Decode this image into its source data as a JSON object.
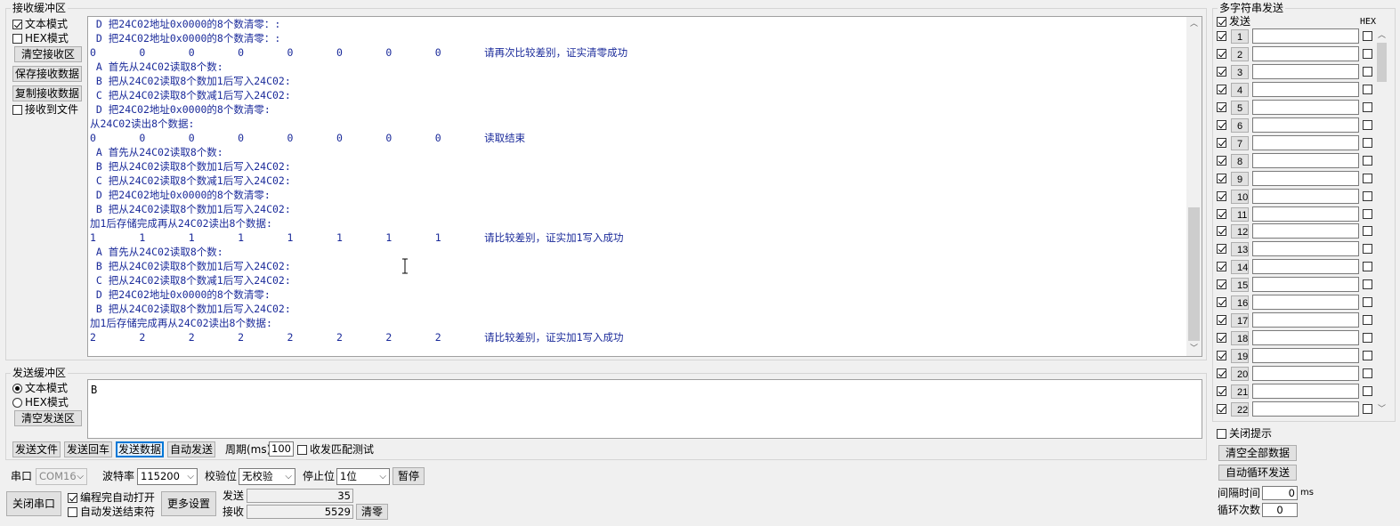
{
  "receive": {
    "group_title": "接收缓冲区",
    "text_mode": "文本模式",
    "hex_mode": "HEX模式",
    "clear_button": "清空接收区",
    "save_button": "保存接收数据",
    "copy_button": "复制接收数据",
    "to_file": "接收到文件",
    "lines": [
      " D 把24C02地址0x0000的8个数清零：:",
      " D 把24C02地址0x0000的8个数清零：:",
      "0       0       0       0       0       0       0       0       请再次比较差别，证实清零成功",
      " A 首先从24C02读取8个数:",
      " B 把从24C02读取8个数加1后写入24C02:",
      " C 把从24C02读取8个数减1后写入24C02:",
      " D 把24C02地址0x0000的8个数清零:",
      "从24C02读出8个数据:",
      "0       0       0       0       0       0       0       0       读取结束",
      " A 首先从24C02读取8个数:",
      " B 把从24C02读取8个数加1后写入24C02:",
      " C 把从24C02读取8个数减1后写入24C02:",
      " D 把24C02地址0x0000的8个数清零:",
      " B 把从24C02读取8个数加1后写入24C02:",
      "加1后存储完成再从24C02读出8个数据:",
      "1       1       1       1       1       1       1       1       请比较差别，证实加1写入成功",
      " A 首先从24C02读取8个数:",
      " B 把从24C02读取8个数加1后写入24C02:",
      " C 把从24C02读取8个数减1后写入24C02:",
      " D 把24C02地址0x0000的8个数清零:",
      " B 把从24C02读取8个数加1后写入24C02:",
      "加1后存储完成再从24C02读出8个数据:",
      "2       2       2       2       2       2       2       2       请比较差别，证实加1写入成功"
    ]
  },
  "send": {
    "group_title": "发送缓冲区",
    "text_mode": "文本模式",
    "hex_mode": "HEX模式",
    "clear_button": "清空发送区",
    "content": "B",
    "send_file": "发送文件",
    "send_newline": "发送回车",
    "send_data": "发送数据",
    "auto_send": "自动发送",
    "period_label": "周期(ms)",
    "period_value": "100",
    "match_test": "收发匹配测试"
  },
  "port": {
    "port_label": "串口",
    "port_value": "COM16",
    "baud_label": "波特率",
    "baud_value": "115200",
    "parity_label": "校验位",
    "parity_value": "无校验",
    "stop_label": "停止位",
    "stop_value": "1位",
    "pause_button": "暂停",
    "close_port": "关闭串口",
    "auto_open": "编程完自动打开",
    "auto_end": "自动发送结束符",
    "more_settings": "更多设置",
    "sent_label": "发送",
    "sent_value": "35",
    "recv_label": "接收",
    "recv_value": "5529",
    "clear_count": "清零"
  },
  "multi": {
    "group_title": "多字符串发送",
    "send_header": "发送",
    "hex_header": "HEX",
    "rows": [
      "1",
      "2",
      "3",
      "4",
      "5",
      "6",
      "7",
      "8",
      "9",
      "10",
      "11",
      "12",
      "13",
      "14",
      "15",
      "16",
      "17",
      "18",
      "19",
      "20",
      "21",
      "22"
    ],
    "close_tips": "关闭提示",
    "clear_all": "清空全部数据",
    "auto_loop": "自动循环发送",
    "interval_label": "间隔时间",
    "interval_value": "0",
    "interval_unit": "ms",
    "loop_label": "循环次数",
    "loop_value": "0"
  }
}
